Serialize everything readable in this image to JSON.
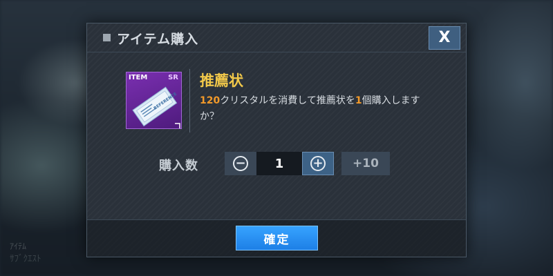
{
  "background": {
    "faded_text_1": "ｱｲﾃﾑ",
    "faded_text_2": "ｻﾌﾞｸｴｽﾄ"
  },
  "dialog": {
    "title": "アイテム購入",
    "close_label": "X"
  },
  "item": {
    "tag": "ITEM",
    "rarity": "SR",
    "art_text": "REFERENCE",
    "name": "推薦状",
    "desc_cost": "120",
    "desc_part1": "クリスタルを消費して推薦状を",
    "desc_count": "1",
    "desc_part2": "個購入しますか？"
  },
  "quantity": {
    "label": "購入数",
    "minus_icon": "minus-circle-icon",
    "value": "1",
    "plus_icon": "plus-circle-icon",
    "plus10_label": "+10"
  },
  "footer": {
    "confirm_label": "確定"
  },
  "colors": {
    "accent_blue": "#2b91f5",
    "highlight_orange": "#f39a2a",
    "item_name_gold": "#f1c84a",
    "item_card_purple": "#6a28a0"
  }
}
